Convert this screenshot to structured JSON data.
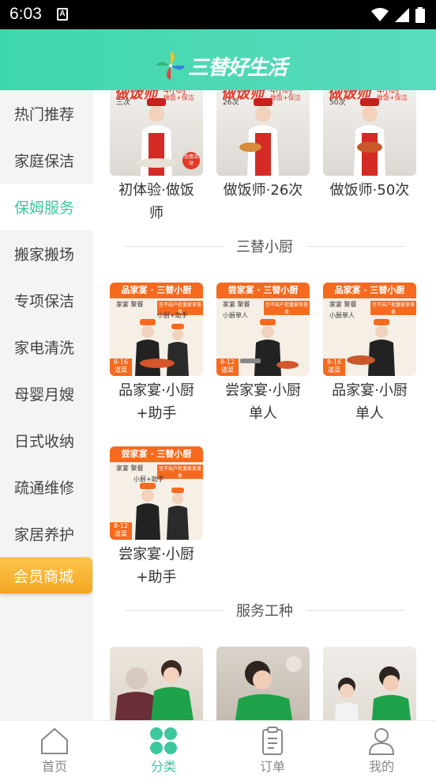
{
  "status": {
    "time": "6:03",
    "a_icon": "A"
  },
  "header": {
    "logo_text": "三替好生活"
  },
  "sidebar": {
    "items": [
      {
        "label": "热门推荐"
      },
      {
        "label": "家庭保洁"
      },
      {
        "label": "保姆服务"
      },
      {
        "label": "搬家搬场"
      },
      {
        "label": "专项保洁"
      },
      {
        "label": "家电清洗"
      },
      {
        "label": "母婴月嫂"
      },
      {
        "label": "日式收纳"
      },
      {
        "label": "疏通维修"
      },
      {
        "label": "家居养护"
      },
      {
        "label": "会员商城"
      }
    ],
    "active_index": 2
  },
  "content": {
    "top_cards": [
      {
        "title_line1": "初体验·做饭",
        "title_line2": "师",
        "banner": "做饭师",
        "banner_sub": "4小时",
        "tag": "做饭+保洁",
        "count": "三次",
        "badge": "优惠活动"
      },
      {
        "title_line1": "做饭师·26次",
        "title_line2": "",
        "banner": "做饭师",
        "banner_sub": "4小时",
        "tag": "做饭+保洁",
        "count": "26次",
        "badge": ""
      },
      {
        "title_line1": "做饭师·50次",
        "title_line2": "",
        "banner": "做饭师",
        "banner_sub": "4小时",
        "tag": "做饭+保洁",
        "count": "50次",
        "badge": ""
      }
    ],
    "section_chef": "三替小厨",
    "chef_cards": [
      {
        "title_line1": "品家宴·小厨",
        "title_line2": "+助手",
        "banner": "品家宴 · 三替小厨",
        "sub1": "家宴  聚餐",
        "sub2": "小厨+助手",
        "note": "豆不出户批量家享美食",
        "dishes": "8-16",
        "dishes_unit": "道菜"
      },
      {
        "title_line1": "尝家宴·小厨",
        "title_line2": "单人",
        "banner": "尝家宴 · 三替小厨",
        "sub1": "家宴  聚餐",
        "sub2": "小厨单人",
        "note": "豆不出户批量家享美食",
        "dishes": "8-12",
        "dishes_unit": "道菜"
      },
      {
        "title_line1": "品家宴·小厨",
        "title_line2": "单人",
        "banner": "品家宴 · 三替小厨",
        "sub1": "家宴  聚餐",
        "sub2": "小厨单人",
        "note": "豆不出户批量家享美食",
        "dishes": "8-16",
        "dishes_unit": "道菜"
      },
      {
        "title_line1": "尝家宴·小厨",
        "title_line2": "+助手",
        "banner": "尝家宴 · 三替小厨",
        "sub1": "家宴  聚餐",
        "sub2": "小厨+助手",
        "note": "豆不出户批量家享美食",
        "dishes": "8-12",
        "dishes_unit": "道菜"
      }
    ],
    "section_service": "服务工种"
  },
  "tabbar": {
    "tabs": [
      {
        "label": "首页"
      },
      {
        "label": "分类"
      },
      {
        "label": "订单"
      },
      {
        "label": "我的"
      }
    ],
    "active_index": 1
  },
  "colors": {
    "brand": "#3cc79f",
    "vip": "#f4a622",
    "chef_orange": "#f56a1e"
  }
}
